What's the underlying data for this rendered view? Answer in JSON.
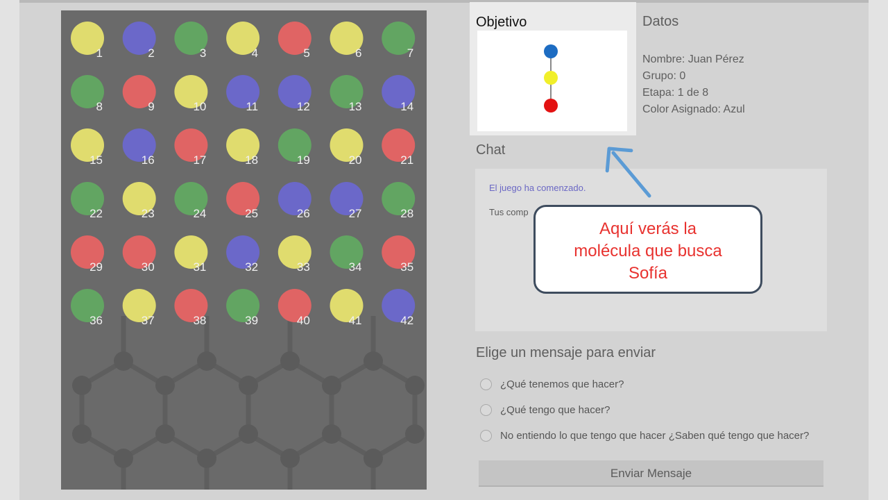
{
  "board": {
    "pieces": [
      {
        "n": "1",
        "c": "yellow"
      },
      {
        "n": "2",
        "c": "blue"
      },
      {
        "n": "3",
        "c": "green"
      },
      {
        "n": "4",
        "c": "yellow"
      },
      {
        "n": "5",
        "c": "red"
      },
      {
        "n": "6",
        "c": "yellow"
      },
      {
        "n": "7",
        "c": "green"
      },
      {
        "n": "8",
        "c": "green"
      },
      {
        "n": "9",
        "c": "red"
      },
      {
        "n": "10",
        "c": "yellow"
      },
      {
        "n": "11",
        "c": "blue"
      },
      {
        "n": "12",
        "c": "blue"
      },
      {
        "n": "13",
        "c": "green"
      },
      {
        "n": "14",
        "c": "blue"
      },
      {
        "n": "15",
        "c": "yellow"
      },
      {
        "n": "16",
        "c": "blue"
      },
      {
        "n": "17",
        "c": "red"
      },
      {
        "n": "18",
        "c": "yellow"
      },
      {
        "n": "19",
        "c": "green"
      },
      {
        "n": "20",
        "c": "yellow"
      },
      {
        "n": "21",
        "c": "red"
      },
      {
        "n": "22",
        "c": "green"
      },
      {
        "n": "23",
        "c": "yellow"
      },
      {
        "n": "24",
        "c": "green"
      },
      {
        "n": "25",
        "c": "red"
      },
      {
        "n": "26",
        "c": "blue"
      },
      {
        "n": "27",
        "c": "blue"
      },
      {
        "n": "28",
        "c": "green"
      },
      {
        "n": "29",
        "c": "red"
      },
      {
        "n": "30",
        "c": "red"
      },
      {
        "n": "31",
        "c": "yellow"
      },
      {
        "n": "32",
        "c": "blue"
      },
      {
        "n": "33",
        "c": "yellow"
      },
      {
        "n": "34",
        "c": "green"
      },
      {
        "n": "35",
        "c": "red"
      },
      {
        "n": "36",
        "c": "green"
      },
      {
        "n": "37",
        "c": "yellow"
      },
      {
        "n": "38",
        "c": "red"
      },
      {
        "n": "39",
        "c": "green"
      },
      {
        "n": "40",
        "c": "red"
      },
      {
        "n": "41",
        "c": "yellow"
      },
      {
        "n": "42",
        "c": "blue"
      }
    ],
    "colors": {
      "yellow": "#e0dc6e",
      "blue": "#6b68c9",
      "green": "#62a562",
      "red": "#e06464"
    }
  },
  "objective": {
    "title": "Objetivo",
    "molecule": [
      {
        "color": "#1d6cc2",
        "name": "blue"
      },
      {
        "color": "#f1ef2a",
        "name": "yellow"
      },
      {
        "color": "#e31212",
        "name": "red"
      }
    ]
  },
  "datos": {
    "title": "Datos",
    "nombre": "Nombre: Juan Pérez",
    "grupo": "Grupo: 0",
    "etapa": "Etapa: 1 de 8",
    "color": "Color Asignado: Azul"
  },
  "chat": {
    "title": "Chat",
    "messages": [
      "El juego ha comenzado.",
      "Tus comp"
    ]
  },
  "callout": {
    "lines": [
      "Aquí verás la",
      "molécula que busca",
      "Sofía"
    ]
  },
  "compose": {
    "title": "Elige un mensaje para enviar",
    "options": [
      "¿Qué tenemos que hacer?",
      "¿Qué tengo que hacer?",
      "No entiendo lo que tengo que hacer ¿Saben qué tengo que hacer?"
    ],
    "send_label": "Enviar Mensaje"
  }
}
